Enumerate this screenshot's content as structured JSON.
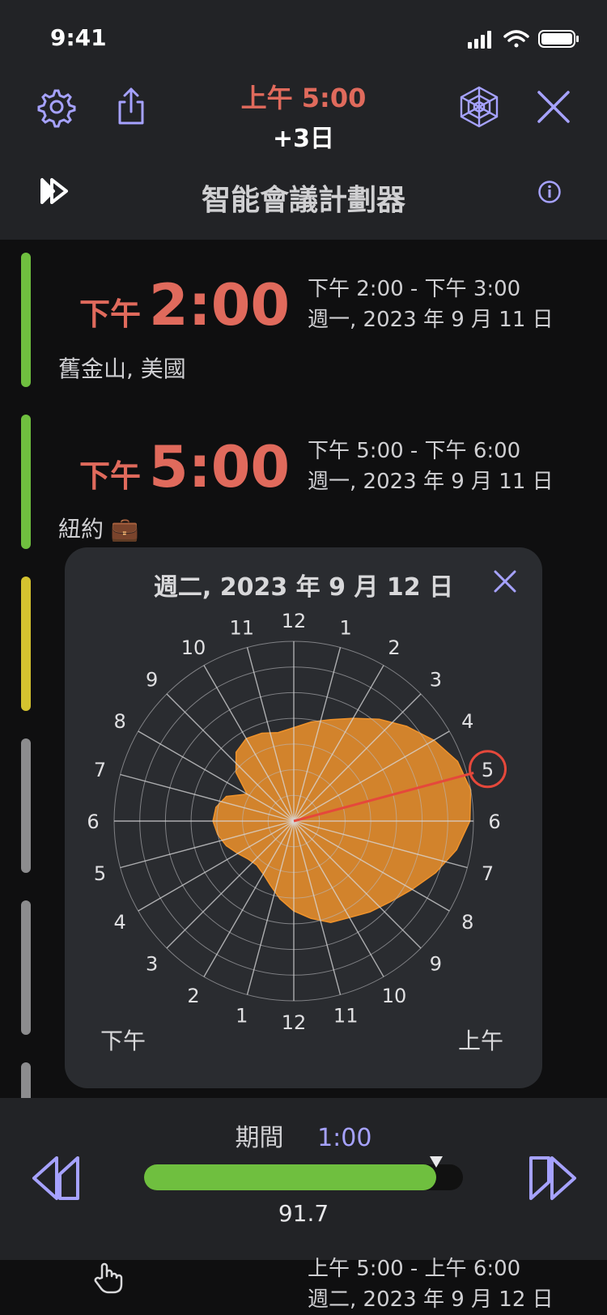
{
  "status": {
    "time": "9:41"
  },
  "header": {
    "time_main": "上午 5:00",
    "time_offset": "+3日",
    "title": "智能會議計劃器"
  },
  "meetings": [
    {
      "prefix": "下午",
      "big_time": "2:00",
      "range": "下午 2:00 - 下午 3:00",
      "date": "週一, 2023 年 9 月 11 日",
      "city": "舊金山, 美國",
      "bar_color": "#6fbf3f"
    },
    {
      "prefix": "下午",
      "big_time": "5:00",
      "range": "下午 5:00 - 下午 6:00",
      "date": "週一, 2023 年 9 月 11 日",
      "city": "紐約 💼",
      "bar_color": "#6fbf3f"
    }
  ],
  "side_bars": [
    "#6fbf3f",
    "#6fbf3f",
    "#d4c22f",
    "#8c8c8e",
    "#8c8c8e",
    "#8c8c8e",
    "#8c8c8e"
  ],
  "popup": {
    "title": "週二, 2023 年 9 月 12 日",
    "right_hours": [
      "12",
      "1",
      "2",
      "3",
      "4",
      "5",
      "6",
      "7",
      "8",
      "9",
      "10",
      "11",
      "12"
    ],
    "left_hours": [
      "12",
      "11",
      "10",
      "9",
      "8",
      "7",
      "6",
      "5",
      "4",
      "3",
      "2",
      "1",
      "12"
    ],
    "pm_label": "下午",
    "am_label": "上午",
    "selected_hour": "5",
    "polar_values": [
      0.52,
      0.56,
      0.6,
      0.66,
      0.74,
      0.82,
      0.9,
      0.97,
      1.0,
      0.98,
      0.92,
      0.84,
      0.76,
      0.7,
      0.66,
      0.62,
      0.6,
      0.55,
      0.5,
      0.44,
      0.38,
      0.34,
      0.32,
      0.33,
      0.36,
      0.4,
      0.43,
      0.45,
      0.44,
      0.4,
      0.3,
      0.42,
      0.5,
      0.53,
      0.52,
      0.5
    ]
  },
  "bottom": {
    "duration_label": "期間",
    "duration_value": "1:00",
    "progress": 0.917,
    "progress_text": "91.7"
  },
  "footer": {
    "range": "上午 5:00 - 上午 6:00",
    "date": "週二, 2023 年 9 月 12 日"
  },
  "colors": {
    "accent": "#a6a2ff",
    "time_red": "#e06a5c",
    "polar_fill": "#f0932b",
    "green": "#6fbf3f"
  }
}
